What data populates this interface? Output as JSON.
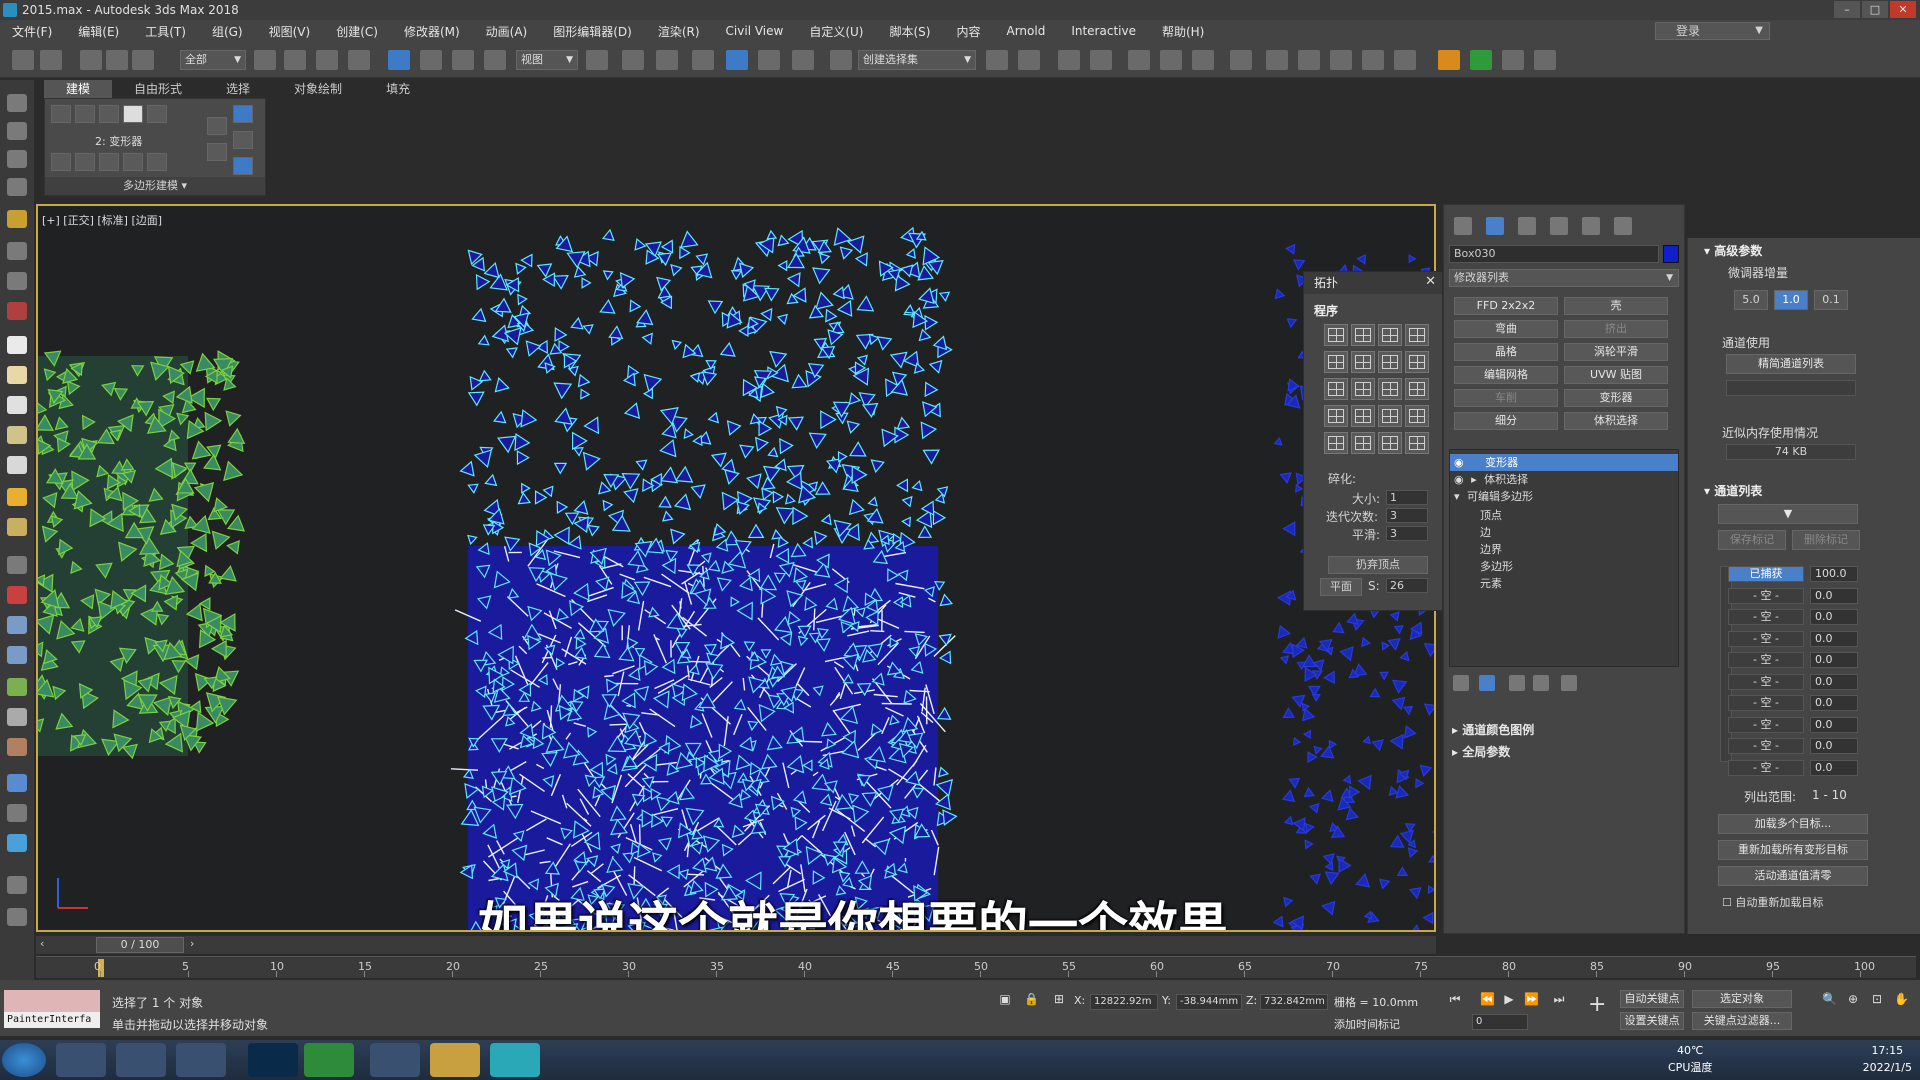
{
  "window": {
    "title": "2015.max - Autodesk 3ds Max 2018"
  },
  "menu": [
    "文件(F)",
    "编辑(E)",
    "工具(T)",
    "组(G)",
    "视图(V)",
    "创建(C)",
    "修改器(M)",
    "动画(A)",
    "图形编辑器(D)",
    "渲染(R)",
    "Civil View",
    "自定义(U)",
    "脚本(S)",
    "内容",
    "Arnold",
    "Interactive",
    "帮助(H)"
  ],
  "login": "登录",
  "toolbar": {
    "selection_filter": "全部",
    "view_combo": "视图",
    "named_selection": "创建选择集"
  },
  "ribbon": {
    "tabs": [
      "建模",
      "自由形式",
      "选择",
      "对象绘制",
      "填充"
    ],
    "active_tab": "建模",
    "sub_label": "2: 变形器",
    "footer": "多边形建模 ▾"
  },
  "viewport": {
    "label": "[+] [正交] [标准] [边面]",
    "subtitle": "如果说这个就是你想要的一个效果"
  },
  "topology": {
    "title": "拓扑",
    "section": "程序",
    "fracture_label": "碎化:",
    "size_label": "大小:",
    "size_value": "1",
    "iterations_label": "迭代次数:",
    "iterations_value": "3",
    "smooth_label": "平滑:",
    "smooth_value": "3",
    "discard_button": "扔弃顶点",
    "plane_button": "平面",
    "s_label": "S:",
    "s_value": "26"
  },
  "command_panel": {
    "object_name": "Box030",
    "object_color": "#1020c8",
    "modifier_list": "修改器列表",
    "buttons": [
      {
        "label": "FFD 2x2x2",
        "dim": false
      },
      {
        "label": "壳",
        "dim": false
      },
      {
        "label": "弯曲",
        "dim": false
      },
      {
        "label": "挤出",
        "dim": true
      },
      {
        "label": "晶格",
        "dim": false
      },
      {
        "label": "涡轮平滑",
        "dim": false
      },
      {
        "label": "编辑网格",
        "dim": false
      },
      {
        "label": "UVW 贴图",
        "dim": false
      },
      {
        "label": "车削",
        "dim": true
      },
      {
        "label": "变形器",
        "dim": false
      },
      {
        "label": "细分",
        "dim": false
      },
      {
        "label": "体积选择",
        "dim": false
      }
    ],
    "stack": [
      {
        "label": "变形器",
        "selected": true
      },
      {
        "label": "体积选择",
        "selected": false
      },
      {
        "label": "可编辑多边形",
        "selected": false
      }
    ],
    "stack_sub": [
      "顶点",
      "边",
      "边界",
      "多边形",
      "元素"
    ],
    "rollouts": [
      "通道颜色图例",
      "全局参数"
    ]
  },
  "morpher": {
    "advanced_header": "高级参数",
    "spinner_inc": "微调器增量",
    "inc_values": [
      "5.0",
      "1.0",
      "0.1"
    ],
    "inc_active": "1.0",
    "channel_use": "通道使用",
    "compact_button": "精简通道列表",
    "memory_label": "近似内存使用情况",
    "memory_value": "74 KB",
    "channel_list_header": "通道列表",
    "save_marker": "保存标记",
    "delete_marker": "删除标记",
    "channels": [
      {
        "name": "已捕获",
        "value": "100.0",
        "active": true
      },
      {
        "name": "- 空 -",
        "value": "0.0",
        "active": false
      },
      {
        "name": "- 空 -",
        "value": "0.0",
        "active": false
      },
      {
        "name": "- 空 -",
        "value": "0.0",
        "active": false
      },
      {
        "name": "- 空 -",
        "value": "0.0",
        "active": false
      },
      {
        "name": "- 空 -",
        "value": "0.0",
        "active": false
      },
      {
        "name": "- 空 -",
        "value": "0.0",
        "active": false
      },
      {
        "name": "- 空 -",
        "value": "0.0",
        "active": false
      },
      {
        "name": "- 空 -",
        "value": "0.0",
        "active": false
      },
      {
        "name": "- 空 -",
        "value": "0.0",
        "active": false
      }
    ],
    "list_range_label": "列出范围:",
    "list_range_value": "1 - 10",
    "load_multiple": "加载多个目标...",
    "reload_all": "重新加载所有变形目标",
    "zero_active": "活动通道值清零",
    "auto_reload": "自动重新加载目标"
  },
  "timeslider": {
    "position": "0 / 100"
  },
  "timeline": {
    "ticks": [
      "0",
      "5",
      "10",
      "15",
      "20",
      "25",
      "30",
      "35",
      "40",
      "45",
      "50",
      "55",
      "60",
      "65",
      "70",
      "75",
      "80",
      "85",
      "90",
      "95",
      "100"
    ]
  },
  "status": {
    "mini_text": "PainterInterfa",
    "selected": "选择了 1 个 对象",
    "hint": "单击并拖动以选择并移动对象",
    "x": "12822.92m",
    "y": "-38.944mm",
    "z": "732.842mm",
    "grid": "栅格 = 10.0mm",
    "add_time_tag": "添加时间标记",
    "auto_key": "自动关键点",
    "set_key": "设置关键点",
    "selected_obj": "选定对象",
    "key_filters": "关键点过滤器...",
    "frame": "0"
  },
  "taskbar": {
    "cpu_temp": "40℃",
    "cpu_label": "CPU温度",
    "time": "17:15",
    "date": "2022/1/5"
  }
}
